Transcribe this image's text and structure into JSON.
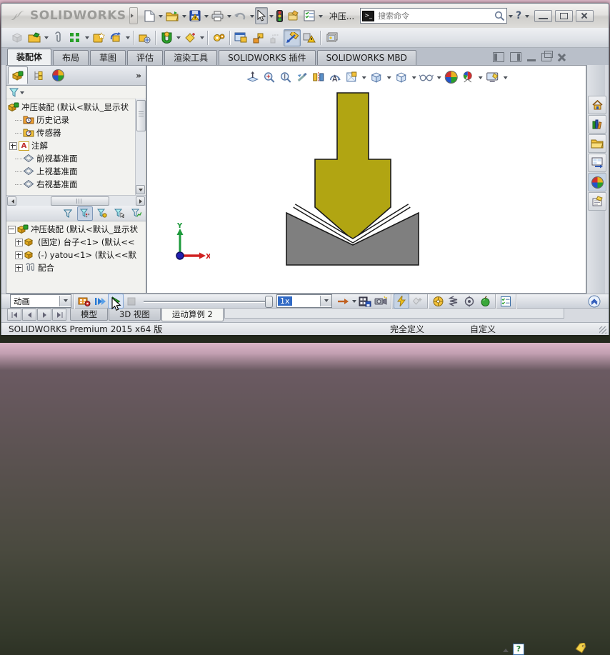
{
  "titlebar": {
    "logo_text": "SOLIDWORKS",
    "document_name": "冲压...",
    "search_placeholder": "搜索命令",
    "help_glyph": "?",
    "icons": [
      "new-document-icon",
      "open-icon",
      "save-icon",
      "print-icon",
      "undo-icon",
      "select-arrow-icon",
      "rebuild-traffic-light-icon",
      "options-icon",
      "file-properties-icon",
      "search-console-icon",
      "search-magnifier-icon",
      "help-icon",
      "minimize-icon",
      "restore-icon",
      "close-icon"
    ]
  },
  "toolbar2": {
    "icons": [
      "insert-component-icon",
      "open-part-icon",
      "attachment-paperclip-icon",
      "linear-pattern-icon",
      "smart-fasteners-icon",
      "rotate-component-icon",
      "move-component-icon",
      "mate-icon",
      "smart-mate-icon",
      "assembly-gears-icon",
      "assembly-window-icon",
      "exploded-view-icon",
      "explode-line-icon",
      "route-line-icon",
      "interference-detection-icon",
      "motion-study-photos-icon"
    ]
  },
  "command_manager": {
    "tabs": [
      {
        "label": "装配体",
        "active": true
      },
      {
        "label": "布局",
        "active": false
      },
      {
        "label": "草图",
        "active": false
      },
      {
        "label": "评估",
        "active": false
      },
      {
        "label": "渲染工具",
        "active": false
      },
      {
        "label": "SOLIDWORKS 插件",
        "active": false
      },
      {
        "label": "SOLIDWORKS MBD",
        "active": false
      }
    ]
  },
  "left_panel": {
    "tab_icons": [
      "feature-tree-icon",
      "display-manager-icon",
      "appearance-ball-icon",
      "expand-chevrons-icon"
    ],
    "expand_label": "»",
    "filter_icon": "filter-funnel-icon",
    "feature_tree": {
      "root_label": "冲压装配 (默认<默认_显示状",
      "items": [
        {
          "label": "历史记录",
          "icon": "history-folder-icon"
        },
        {
          "label": "传感器",
          "icon": "sensors-folder-icon"
        },
        {
          "label": "注解",
          "icon": "annotations-icon"
        },
        {
          "label": "前视基准面",
          "icon": "plane-icon"
        },
        {
          "label": "上视基准面",
          "icon": "plane-icon"
        },
        {
          "label": "右视基准面",
          "icon": "plane-icon"
        }
      ],
      "annotation_letter": "A"
    },
    "motion_filter_icons": [
      "filter-none-icon",
      "filter-animated-icon",
      "filter-driving-icon",
      "filter-selected-icon",
      "filter-results-icon"
    ],
    "motion_tree": {
      "root_label": "冲压装配 (默认<默认_显示状",
      "items": [
        {
          "label": "(固定) 台子<1> (默认<<",
          "icon": "component-icon"
        },
        {
          "label": "(-) yatou<1> (默认<<默",
          "icon": "component-icon"
        },
        {
          "label": "配合",
          "icon": "mates-paperclip-icon"
        }
      ]
    }
  },
  "viewport": {
    "headsup_icons": [
      "zoom-to-fit-icon",
      "zoom-to-area-icon",
      "zoom-in-out-icon",
      "previous-view-icon",
      "section-view-icon",
      "view-orientation-icon",
      "view-selector-icon",
      "display-style-icon",
      "display-style-alt-icon",
      "hide-show-items-icon",
      "edit-appearance-icon",
      "apply-scene-icon",
      "view-settings-icon"
    ],
    "triad": {
      "x_label": "X",
      "y_label": "Y"
    },
    "model_colors": {
      "punch": "#b1a512",
      "die": "#7f7f7f",
      "sheet": "#ffffff",
      "outline": "#1a1a1a"
    }
  },
  "taskpane": {
    "icons": [
      "resources-home-icon",
      "design-library-icon",
      "file-explorer-icon",
      "view-palette-icon",
      "appearances-scenes-icon",
      "custom-properties-icon"
    ]
  },
  "motion_bar": {
    "study_type_value": "动画",
    "speed_value": "1x",
    "icons": [
      "calculate-icon",
      "play-from-start-icon",
      "play-icon",
      "stop-icon",
      "timeline-slider",
      "playback-mode-arrow-icon",
      "save-animation-icon",
      "animation-wizard-icon",
      "autokey-icon",
      "add-key-icon",
      "motor-icon",
      "spring-icon",
      "damper-icon",
      "gravity-icon",
      "study-properties-icon",
      "collapse-chevron-icon"
    ]
  },
  "bottom_tabs": {
    "nav_icons": [
      "first-tab-icon",
      "prev-tab-icon",
      "next-tab-icon",
      "last-tab-icon"
    ],
    "tabs": [
      {
        "label": "模型",
        "active": false
      },
      {
        "label": "3D 视图",
        "active": false
      },
      {
        "label": "运动算例 2",
        "active": true
      }
    ]
  },
  "status_bar": {
    "version_text": "SOLIDWORKS Premium 2015 x64 版",
    "definition_state": "完全定义",
    "toolbar_mode": "自定义",
    "help_glyph": "?",
    "icons": [
      "help-box-icon",
      "tag-icon",
      "resize-grip-icon"
    ]
  },
  "colors": {
    "selection_blue": "#316ac5",
    "punch_yellow": "#b1a512",
    "die_gray": "#7f7f7f"
  }
}
